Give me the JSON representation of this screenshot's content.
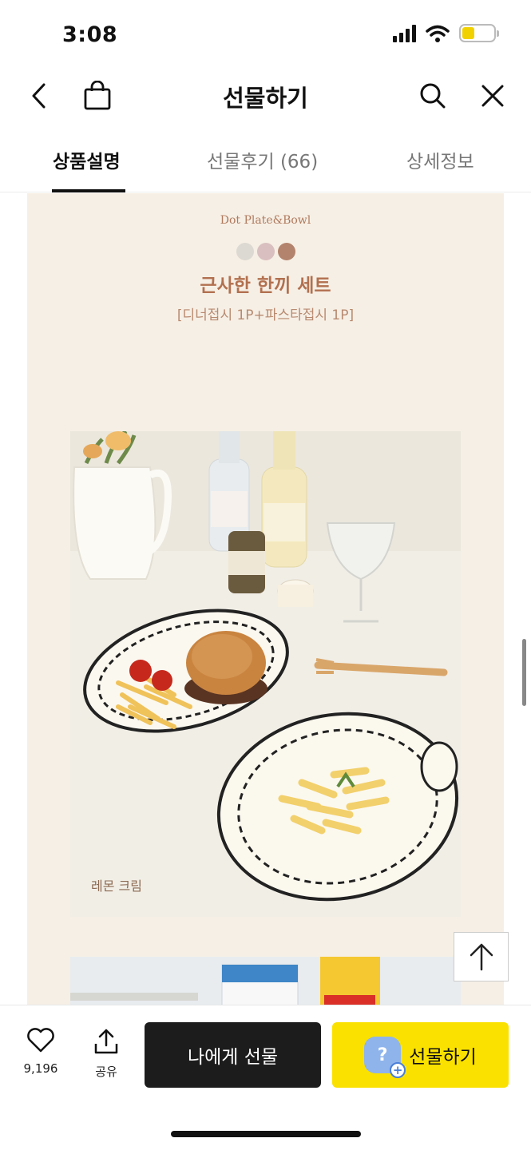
{
  "status": {
    "time": "3:08",
    "battery_level": 0.4
  },
  "nav": {
    "title": "선물하기",
    "back_icon": "chevron-left-icon",
    "bag_icon": "shopping-bag-icon",
    "search_icon": "search-icon",
    "close_icon": "close-icon"
  },
  "tabs": [
    {
      "label": "상품설명",
      "active": true
    },
    {
      "label": "선물후기 (66)",
      "active": false
    },
    {
      "label": "상세정보",
      "active": false
    }
  ],
  "product": {
    "brand": "Dot Plate&Bowl",
    "color_dots": [
      "#dcd9d2",
      "#d9bfbf",
      "#b3836d"
    ],
    "title": "근사한 한끼 세트",
    "subtitle": "[디너접시 1P+파스타접시 1P]",
    "photo_caption": "레몬 크림"
  },
  "bottom": {
    "like_count": "9,196",
    "share_label": "공유",
    "gift_self_label": "나에게 선물",
    "gift_label": "선물하기"
  }
}
